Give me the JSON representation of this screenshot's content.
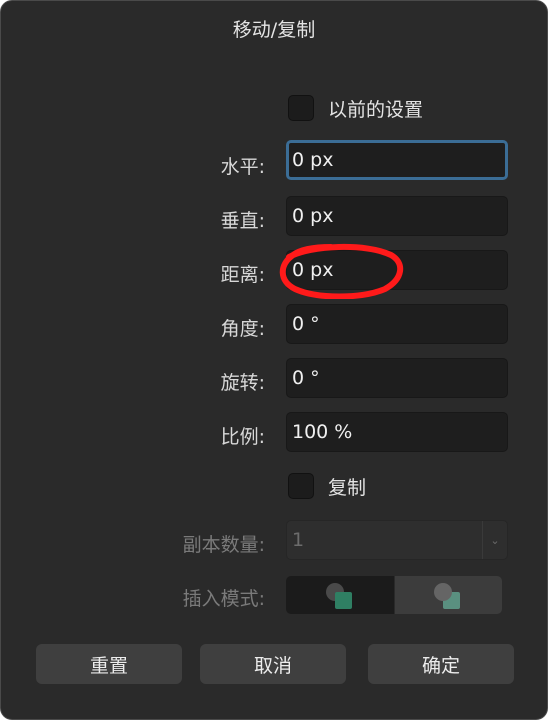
{
  "dialog": {
    "title": "移动/复制"
  },
  "previous_settings": {
    "label": "以前的设置",
    "checked": false
  },
  "fields": {
    "horizontal": {
      "label": "水平:",
      "value": "0 px"
    },
    "vertical": {
      "label": "垂直:",
      "value": "0 px"
    },
    "distance": {
      "label": "距离:",
      "value": "0 px"
    },
    "angle": {
      "label": "角度:",
      "value": "0 °"
    },
    "rotation": {
      "label": "旋转:",
      "value": "0 °"
    },
    "scale": {
      "label": "比例:",
      "value": "100 %"
    }
  },
  "copy": {
    "label": "复制",
    "checked": false
  },
  "copies": {
    "label": "副本数量:",
    "value": "1"
  },
  "insert_mode": {
    "label": "插入模式:"
  },
  "buttons": {
    "reset": "重置",
    "cancel": "取消",
    "ok": "确定"
  },
  "colors": {
    "focus_ring": "#3b6d96",
    "annotation_red": "#ff1a1a",
    "mode_square_active": "#2f7f63",
    "mode_square_inactive": "#5a9080"
  },
  "icons": {
    "insert_above": "overlap-front-icon",
    "insert_below": "overlap-back-icon"
  }
}
